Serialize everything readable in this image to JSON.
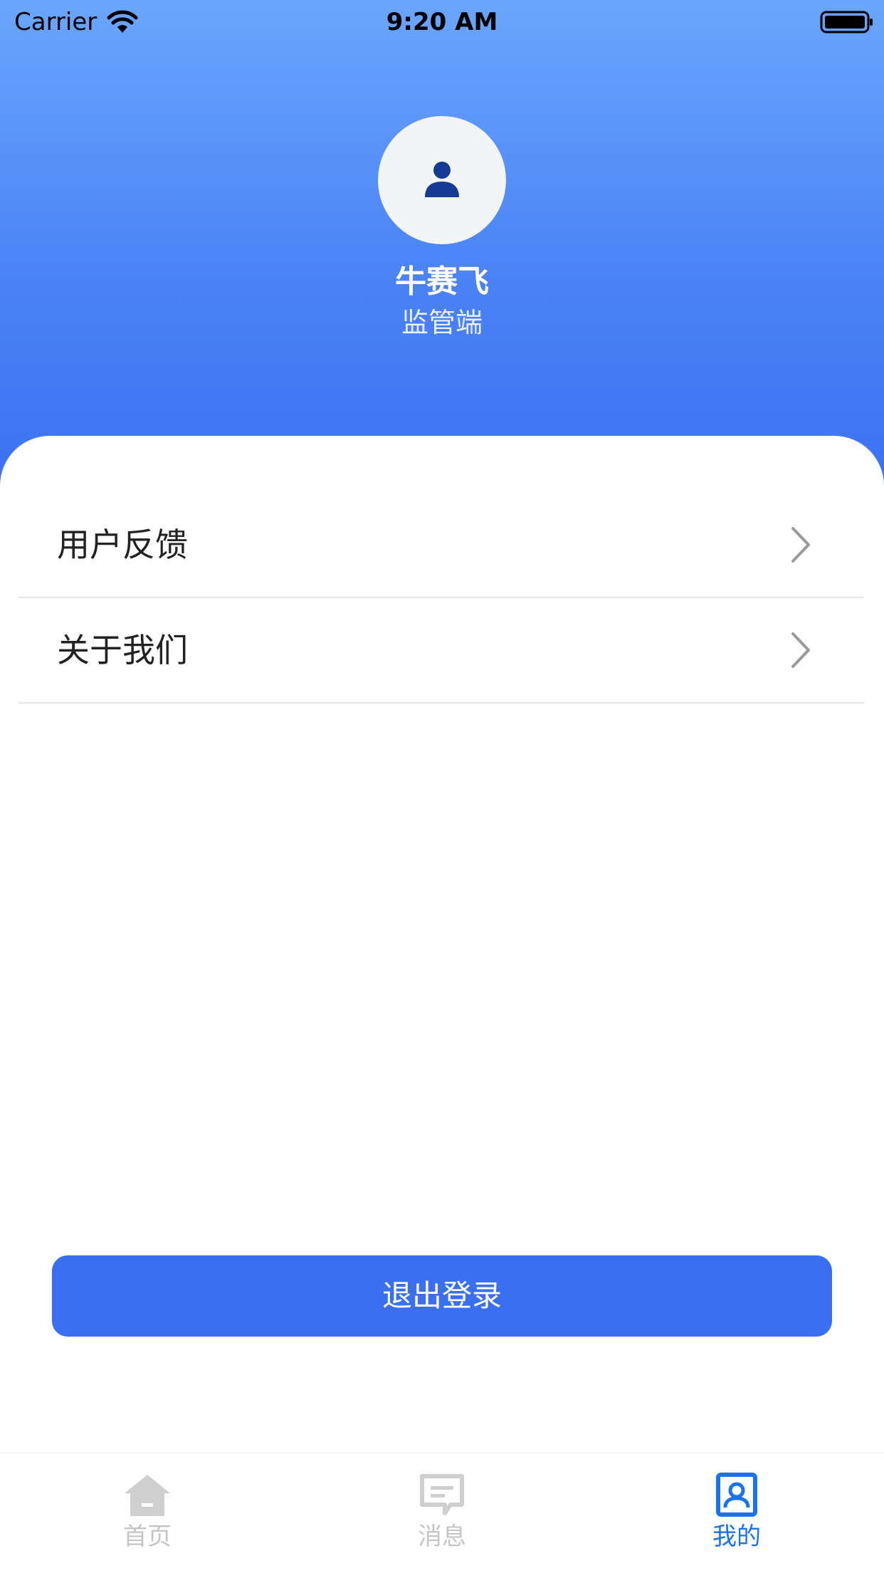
{
  "status_bar": {
    "carrier": "Carrier",
    "time": "9:20 AM"
  },
  "profile": {
    "name": "牛赛飞",
    "role": "监管端"
  },
  "menu": {
    "items": [
      {
        "label": "用户反馈"
      },
      {
        "label": "关于我们"
      }
    ]
  },
  "logout": {
    "label": "退出登录"
  },
  "tabs": [
    {
      "label": "首页",
      "icon": "home-icon",
      "active": false
    },
    {
      "label": "消息",
      "icon": "message-icon",
      "active": false
    },
    {
      "label": "我的",
      "icon": "profile-icon",
      "active": true
    }
  ],
  "colors": {
    "primary": "#3b6ff2",
    "active_tab": "#1a73e8",
    "inactive_tab": "#c5c5c5",
    "header_top": "#6aa6fd"
  }
}
